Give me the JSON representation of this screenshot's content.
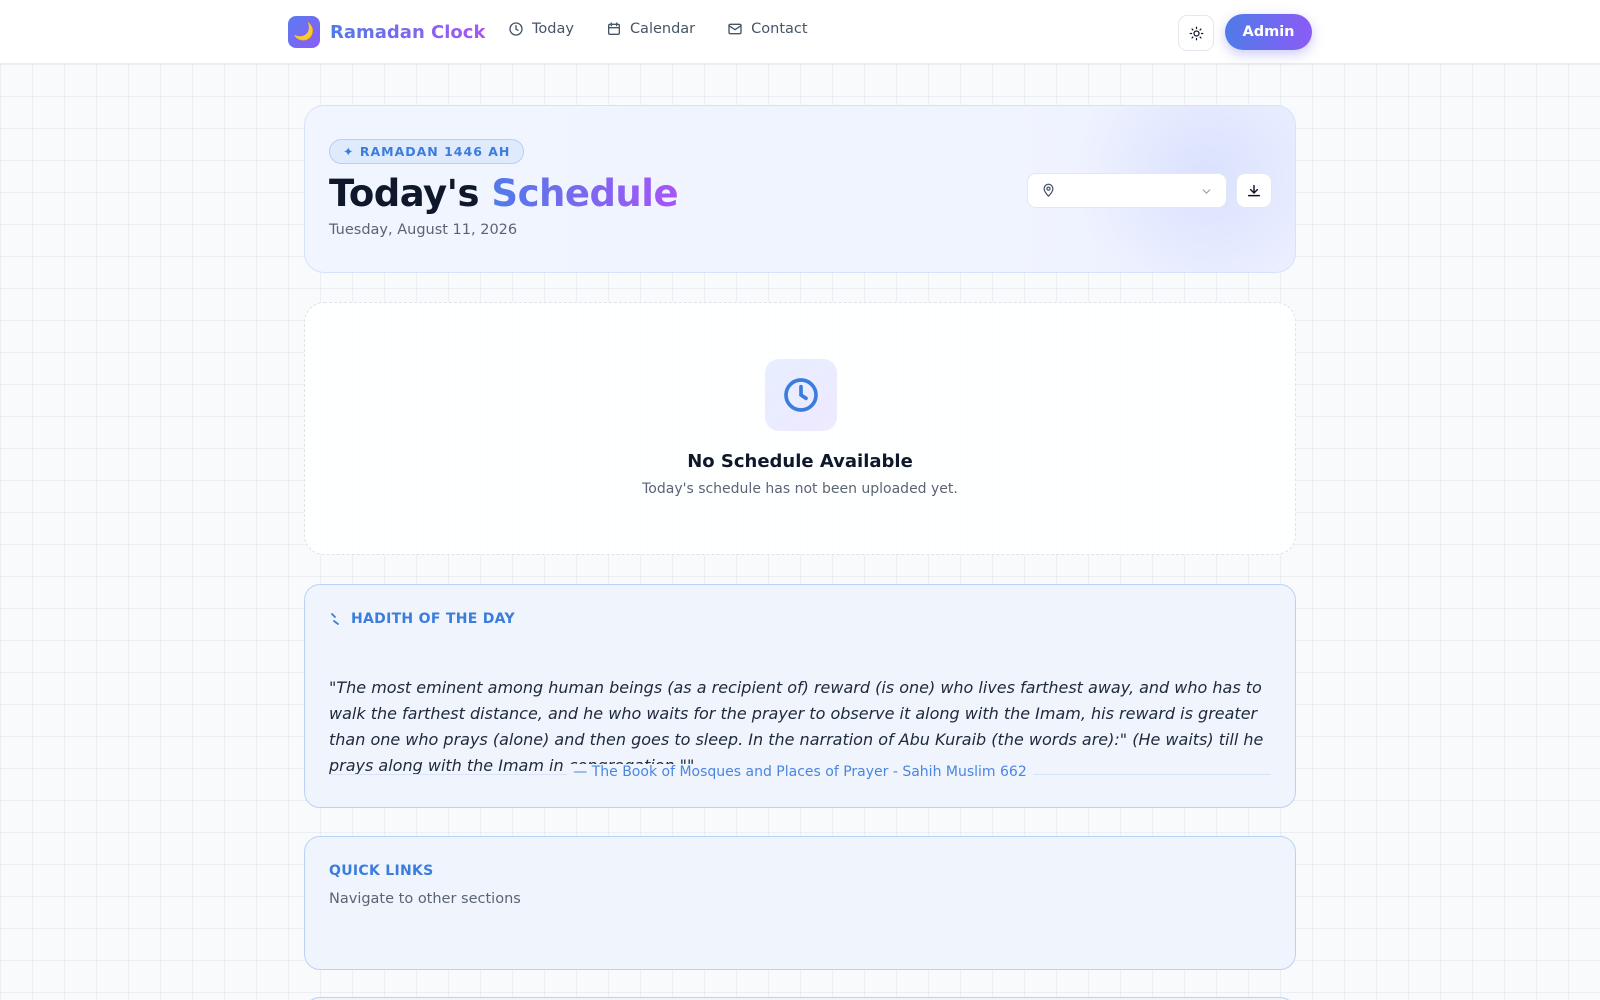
{
  "header": {
    "brand_name": "Ramadan Clock",
    "nav": [
      {
        "label": "Today",
        "icon": "clock-icon"
      },
      {
        "label": "Calendar",
        "icon": "calendar-icon"
      },
      {
        "label": "Contact",
        "icon": "mail-icon"
      }
    ],
    "theme_icon": "sun-icon",
    "admin_label": "Admin"
  },
  "hero": {
    "badge": "✦ RAMADAN 1446 AH",
    "title_main": "Today's ",
    "title_accent": "Schedule",
    "date": "Tuesday, August 11, 2026",
    "location_select_value": ""
  },
  "empty_state": {
    "title": "No Schedule Available",
    "subtitle": "Today's schedule has not been uploaded yet."
  },
  "hadith": {
    "label": "HADITH OF THE DAY",
    "text": "\"The most eminent among human beings (as a recipient of) reward (is one) who lives farthest away, and who has to walk the farthest distance, and he who waits for the prayer to observe it along with the Imam, his reward is greater than one who prays (alone) and then goes to sleep. In the narration of Abu Kuraib (the words are):\" (He waits) till he prays along with the Imam in congregation.\"\"",
    "source": "— The Book of Mosques and Places of Prayer - Sahih Muslim 662"
  },
  "quick_links": {
    "title": "QUICK LINKS",
    "subtitle": "Navigate to other sections"
  },
  "colors": {
    "accent_blue": "#4f7be8",
    "accent_purple": "#a855f7",
    "card_bg": "#eff4fd"
  }
}
